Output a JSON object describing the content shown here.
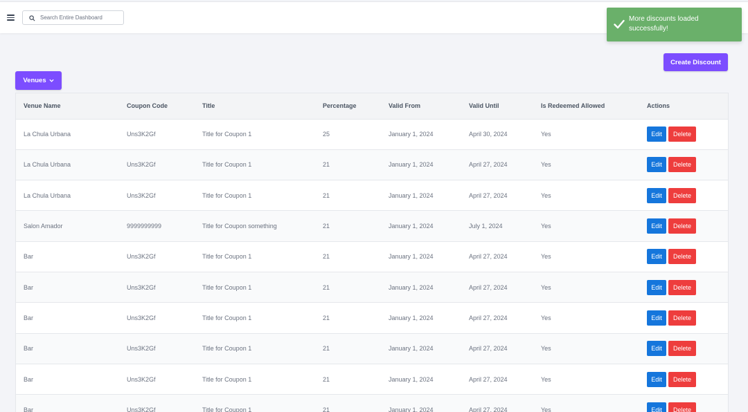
{
  "search": {
    "placeholder": "Search Entire Dashboard",
    "value": ""
  },
  "toast": {
    "message": "More discounts loaded successfully!",
    "color": "#6ab06a"
  },
  "toolbar": {
    "create_label": "Create Discount",
    "venues_label": "Venues",
    "accent": "#7c4dff"
  },
  "table": {
    "headers": [
      "Venue Name",
      "Coupon Code",
      "Title",
      "Percentage",
      "Valid From",
      "Valid Until",
      "Is Redeemed Allowed",
      "Actions"
    ],
    "edit_label": "Edit",
    "delete_label": "Delete",
    "rows": [
      {
        "venue": "La Chula Urbana",
        "code": "Uns3K2Gf",
        "title": "Title for Coupon 1",
        "percentage": "25",
        "valid_from": "January 1, 2024",
        "valid_until": "April 30, 2024",
        "redeemed": "Yes"
      },
      {
        "venue": "La Chula Urbana",
        "code": "Uns3K2Gf",
        "title": "Title for Coupon 1",
        "percentage": "21",
        "valid_from": "January 1, 2024",
        "valid_until": "April 27, 2024",
        "redeemed": "Yes"
      },
      {
        "venue": "La Chula Urbana",
        "code": "Uns3K2Gf",
        "title": "Title for Coupon 1",
        "percentage": "21",
        "valid_from": "January 1, 2024",
        "valid_until": "April 27, 2024",
        "redeemed": "Yes"
      },
      {
        "venue": "Salon Amador",
        "code": "9999999999",
        "title": "Title for Coupon something",
        "percentage": "21",
        "valid_from": "January 1, 2024",
        "valid_until": "July 1, 2024",
        "redeemed": "Yes"
      },
      {
        "venue": "Bar",
        "code": "Uns3K2Gf",
        "title": "Title for Coupon 1",
        "percentage": "21",
        "valid_from": "January 1, 2024",
        "valid_until": "April 27, 2024",
        "redeemed": "Yes"
      },
      {
        "venue": "Bar",
        "code": "Uns3K2Gf",
        "title": "Title for Coupon 1",
        "percentage": "21",
        "valid_from": "January 1, 2024",
        "valid_until": "April 27, 2024",
        "redeemed": "Yes"
      },
      {
        "venue": "Bar",
        "code": "Uns3K2Gf",
        "title": "Title for Coupon 1",
        "percentage": "21",
        "valid_from": "January 1, 2024",
        "valid_until": "April 27, 2024",
        "redeemed": "Yes"
      },
      {
        "venue": "Bar",
        "code": "Uns3K2Gf",
        "title": "Title for Coupon 1",
        "percentage": "21",
        "valid_from": "January 1, 2024",
        "valid_until": "April 27, 2024",
        "redeemed": "Yes"
      },
      {
        "venue": "Bar",
        "code": "Uns3K2Gf",
        "title": "Title for Coupon 1",
        "percentage": "21",
        "valid_from": "January 1, 2024",
        "valid_until": "April 27, 2024",
        "redeemed": "Yes"
      },
      {
        "venue": "Bar",
        "code": "Uns3K2Gf",
        "title": "Title for Coupon 1",
        "percentage": "21",
        "valid_from": "January 1, 2024",
        "valid_until": "April 27, 2024",
        "redeemed": "Yes"
      }
    ]
  }
}
